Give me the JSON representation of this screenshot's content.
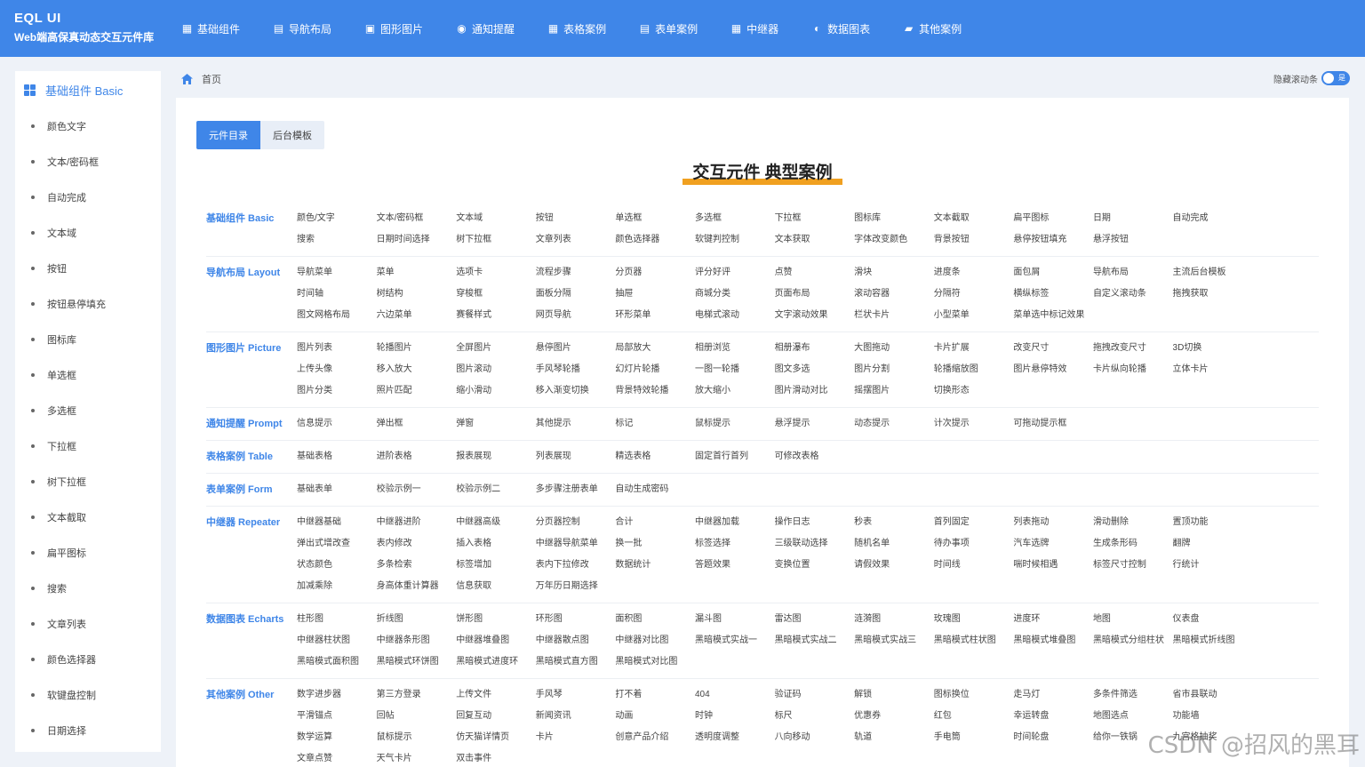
{
  "brand": {
    "title": "EQL UI",
    "subtitle": "Web端高保真动态交互元件库"
  },
  "nav": [
    {
      "label": "基础组件",
      "icon": "grid-icon"
    },
    {
      "label": "导航布局",
      "icon": "layout-icon"
    },
    {
      "label": "图形图片",
      "icon": "image-icon"
    },
    {
      "label": "通知提醒",
      "icon": "bell-icon"
    },
    {
      "label": "表格案例",
      "icon": "table-icon"
    },
    {
      "label": "表单案例",
      "icon": "form-icon"
    },
    {
      "label": "中继器",
      "icon": "repeater-icon"
    },
    {
      "label": "数据图表",
      "icon": "chart-icon"
    },
    {
      "label": "其他案例",
      "icon": "briefcase-icon"
    }
  ],
  "sidebar": {
    "header": "基础组件 Basic",
    "items": [
      "颜色文字",
      "文本/密码框",
      "自动完成",
      "文本域",
      "按钮",
      "按钮悬停填充",
      "图标库",
      "单选框",
      "多选框",
      "下拉框",
      "树下拉框",
      "文本截取",
      "扁平图标",
      "搜索",
      "文章列表",
      "颜色选择器",
      "软键盘控制",
      "日期选择"
    ]
  },
  "breadcrumb": {
    "home": "首页"
  },
  "toggle": {
    "label": "隐藏滚动条",
    "state_text": "是"
  },
  "tabs": {
    "active": "元件目录",
    "inactive": "后台模板"
  },
  "headline": "交互元件 典型案例",
  "categories": [
    {
      "title": "基础组件 Basic",
      "items": [
        "颜色/文字",
        "文本/密码框",
        "文本域",
        "按钮",
        "单选框",
        "多选框",
        "下拉框",
        "图标库",
        "文本截取",
        "扁平图标",
        "日期",
        "自动完成",
        "搜索",
        "日期时间选择",
        "树下拉框",
        "文章列表",
        "颜色选择器",
        "软键判控制",
        "文本获取",
        "字体改变颜色",
        "背景按钮",
        "悬停按钮填充",
        "悬浮按钮"
      ]
    },
    {
      "title": "导航布局 Layout",
      "items": [
        "导航菜单",
        "菜单",
        "选项卡",
        "流程步骤",
        "分页器",
        "评分好评",
        "点赞",
        "滑块",
        "进度条",
        "面包屑",
        "导航布局",
        "主流后台模板",
        "时间轴",
        "树结构",
        "穿梭框",
        "面板分隔",
        "抽屉",
        "商城分类",
        "页面布局",
        "滚动容器",
        "分隔符",
        "横纵标签",
        "自定义滚动条",
        "拖拽获取",
        "图文网格布局",
        "六边菜单",
        "赛餐样式",
        "网页导航",
        "环形菜单",
        "电梯式滚动",
        "文字滚动效果",
        "栏状卡片",
        "小型菜单",
        "菜单选中标记效果"
      ]
    },
    {
      "title": "图形图片 Picture",
      "items": [
        "图片列表",
        "轮播图片",
        "全屏图片",
        "悬停图片",
        "局部放大",
        "相册浏览",
        "相册瀑布",
        "大图拖动",
        "卡片扩展",
        "改变尺寸",
        "拖拽改变尺寸",
        "3D切换",
        "上传头像",
        "移入放大",
        "图片滚动",
        "手风琴轮播",
        "幻灯片轮播",
        "一图一轮播",
        "图文多选",
        "图片分割",
        "轮播缩放图",
        "图片悬停特效",
        "卡片纵向轮播",
        "立体卡片",
        "图片分类",
        "照片匹配",
        "缩小滑动",
        "移入渐变切换",
        "背景特效轮播",
        "放大缩小",
        "图片滑动对比",
        "摇摆图片",
        "切换形态"
      ]
    },
    {
      "title": "通知提醒 Prompt",
      "items": [
        "信息提示",
        "弹出框",
        "弹窗",
        "其他提示",
        "标记",
        "鼠标提示",
        "悬浮提示",
        "动态提示",
        "计次提示",
        "可拖动提示框"
      ]
    },
    {
      "title": "表格案例 Table",
      "items": [
        "基础表格",
        "进阶表格",
        "报表展现",
        "列表展现",
        "精选表格",
        "固定首行首列",
        "可修改表格"
      ]
    },
    {
      "title": "表单案例 Form",
      "items": [
        "基础表单",
        "校验示例一",
        "校验示例二",
        "多步骤注册表单",
        "自动生成密码"
      ]
    },
    {
      "title": "中继器 Repeater",
      "items": [
        "中继器基础",
        "中继器进阶",
        "中继器高级",
        "分页器控制",
        "合计",
        "中继器加载",
        "操作日志",
        "秒表",
        "首列固定",
        "列表拖动",
        "滑动删除",
        "置顶功能",
        "弹出式增改查",
        "表内修改",
        "插入表格",
        "中继器导航菜单",
        "换一批",
        "标签选择",
        "三级联动选择",
        "随机名单",
        "待办事项",
        "汽车选牌",
        "生成条形码",
        "翻牌",
        "状态颜色",
        "多条检索",
        "标签增加",
        "表内下拉修改",
        "数据统计",
        "答题效果",
        "变换位置",
        "请假效果",
        "时间线",
        "喘时候相遇",
        "标签尺寸控制",
        "行统计",
        "加减乘除",
        "身高体重计算器",
        "信息获取",
        "万年历日期选择"
      ]
    },
    {
      "title": "数据图表 Echarts",
      "items": [
        "柱形图",
        "折线图",
        "饼形图",
        "环形图",
        "面积图",
        "漏斗图",
        "雷达图",
        "涟漪图",
        "玫瑰图",
        "进度环",
        "地图",
        "仪表盘",
        "中继器柱状图",
        "中继器条形图",
        "中继器堆叠图",
        "中继器散点图",
        "中继器对比图",
        "黑暗模式实战一",
        "黑暗模式实战二",
        "黑暗模式实战三",
        "黑暗模式柱状图",
        "黑暗模式堆叠图",
        "黑暗模式分组柱状",
        "黑暗模式折线图",
        "黑暗模式面积图",
        "黑暗模式环饼图",
        "黑暗模式进度环",
        "黑暗模式直方图",
        "黑暗模式对比图"
      ]
    },
    {
      "title": "其他案例 Other",
      "items": [
        "数字进步器",
        "第三方登录",
        "上传文件",
        "手风琴",
        "打不着",
        "404",
        "验证码",
        "解锁",
        "图标换位",
        "走马灯",
        "多条件筛选",
        "省市县联动",
        "平滑锚点",
        "回帖",
        "回复互动",
        "新闻资讯",
        "动画",
        "时钟",
        "标尺",
        "优惠券",
        "红包",
        "幸运转盘",
        "地图选点",
        "功能墙",
        "数学运算",
        "鼠标提示",
        "仿天猫详情页",
        "卡片",
        "创意产品介绍",
        "透明度调整",
        "八向移动",
        "轨道",
        "手电筒",
        "时间轮盘",
        "给你一铁锅",
        "九宫格抽奖",
        "文章点赞",
        "天气卡片",
        "双击事件"
      ]
    }
  ],
  "watermark": "CSDN @招风的黑耳",
  "colors": {
    "primary": "#3f86e8",
    "accent": "#f0a020"
  }
}
